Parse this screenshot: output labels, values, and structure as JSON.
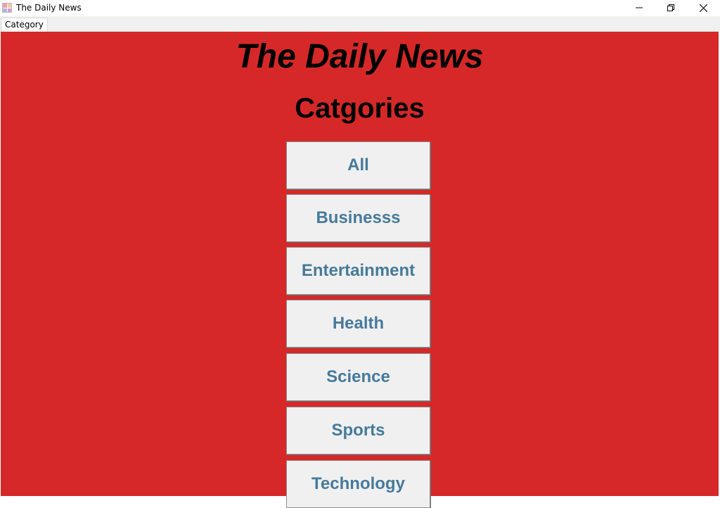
{
  "window": {
    "title": "The Daily News",
    "controls": [
      "minimize-icon",
      "restore-icon",
      "close-icon"
    ]
  },
  "tabs": [
    {
      "label": "Category",
      "selected": true
    }
  ],
  "page": {
    "heading": "The Daily News",
    "subheading": "Catgories"
  },
  "categories": [
    "All",
    "Businesss",
    "Entertainment",
    "Health",
    "Science",
    "Sports",
    "Technology"
  ],
  "colors": {
    "background": "#d62828",
    "button_face": "#f0f0f0",
    "button_text": "#467a9c",
    "heading_text": "#000000"
  }
}
